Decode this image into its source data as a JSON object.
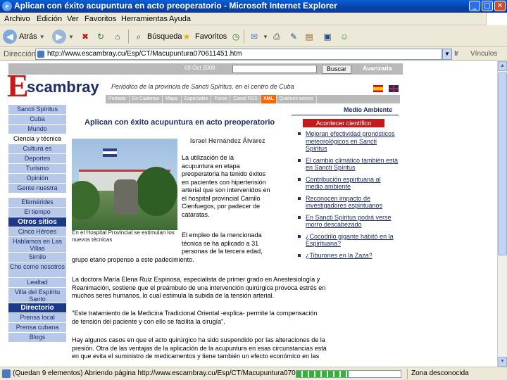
{
  "window": {
    "title": "Aplican con éxito acupuntura en acto preoperatorio - Microsoft Internet Explorer",
    "minimize": "_",
    "maximize": "□",
    "close": "✕"
  },
  "menu": [
    "Archivo",
    "Edición",
    "Ver",
    "Favoritos",
    "Herramientas",
    "Ayuda"
  ],
  "toolbar": {
    "back": "Atrás",
    "search": "Búsqueda",
    "favorites": "Favoritos"
  },
  "address": {
    "label": "Dirección",
    "url": "http://www.escambray.cu/Esp/CT/Macupuntura070611451.htm",
    "go": "Ir",
    "links": "Vínculos"
  },
  "site": {
    "date": "09 Oct 2009",
    "search_button": "Buscar",
    "advanced": "Avanzada",
    "logo_initial": "E",
    "logo_rest": "scambray",
    "tagline": "Periódico de la provincia de Sancti Spíritus, en el centro de Cuba",
    "nav": [
      "Portada",
      "En Cadenas",
      "Mapa",
      "Especiales",
      "Foros",
      "Canal RSS",
      "XML",
      "Quiénes somos"
    ]
  },
  "leftnav": {
    "items1": [
      "Sancti Spíritus",
      "Cuba",
      "Mundo",
      "Ciencia y técnica",
      "Cultura es",
      "Deportes",
      "Turismo",
      "Opinión",
      "Gente nuestra",
      "Efemérides",
      "El tiempo"
    ],
    "selected_index": 3,
    "header_otros": "Otros sitios",
    "items2": [
      "Cinco Héroes",
      "Hablamos en Las Villas",
      "Similo",
      "Cho como nosotros",
      "Lealtad",
      "Villa del Espíritu Santo"
    ],
    "header_directorio": "Directorio",
    "items3": [
      "Prensa local",
      "Prensa cubana",
      "Blogs"
    ]
  },
  "article": {
    "title": "Aplican con éxito acupuntura en acto preoperatorio",
    "author": "Israel Hernández Álvarez",
    "photo_caption": "En el Hospital Provincial se estimulan los nuevos técnicas",
    "para1_lines": [
      "La utilización de la",
      "acupuntura en etapa",
      "preoperatoria ha tenido éxitos",
      "en pacientes con hipertensión",
      "arterial que son intervenidos en",
      "el hospital provincial Camilo",
      "Cienfuegos, por padecer de",
      "cataratas."
    ],
    "para2_lines": [
      "El empleo de la mencionada",
      "técnica se ha aplicado a 31",
      "personas de la tercera edad,"
    ],
    "para2_end": "grupo etario propenso a este padecimiento.",
    "para3": [
      "La doctora María Elena Ruiz Espinosa, especialista de primer grado en Anestesiología y",
      "Reanimación, sostiene que el preámbulo de una intervención quirúrgica provoca estrés en",
      "muchos seres humanos, lo cual estimula la subida de la tensión arterial."
    ],
    "para4": [
      "\"Este tratamiento de la Medicina Tradicional Oriental -explica- permite la compensación",
      "de tensión del paciente y con ello se facilita la cirugía\"."
    ],
    "para5": [
      "Hay algunos casos en que el acto quirúrgico ha sido suspendido por las alteraciones de la",
      "presión. Otra de las ventajas de la aplicación de la acupuntura en esas circunstancias está",
      "en que evita el suministro de medicamentos y tiene también un efecto económico en las"
    ]
  },
  "right": {
    "section": "Medio Ambiente",
    "header": "Acontecer científico",
    "links": [
      "Mejoran efectividad pronósticos meteorológicos en Sancti Spíritus",
      "El cambio climático también está en Sancti Spíritus",
      "Contribución espirituana al medio ambiente",
      "Reconocen impacto de investigadores espirituanos",
      "En Sancti Spíritus podrá verse morro descabezado",
      "¿Cocodrilo gigante habitó en la Espirituana?",
      "¿Tiburones en la Zaza?"
    ]
  },
  "status": {
    "text": "(Quedan 9 elementos) Abriendo página http://www.escambray.cu/Esp/CT/Macupuntura070611451...",
    "progress": 0.5,
    "zone": "Zona desconocida"
  }
}
